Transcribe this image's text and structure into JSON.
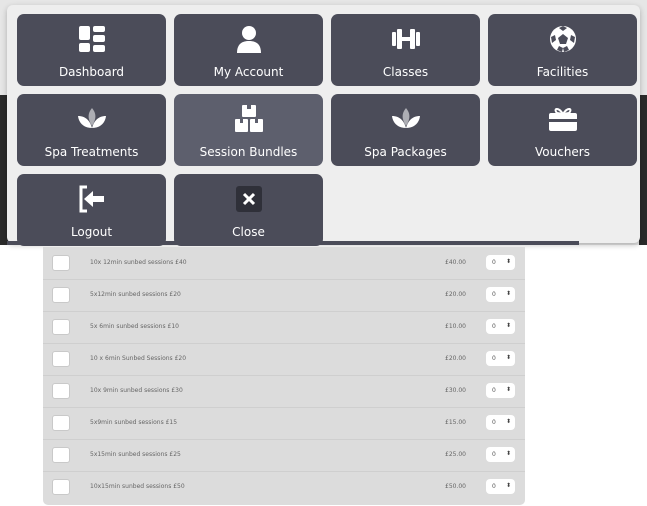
{
  "menu": {
    "tiles": [
      {
        "label": "Dashboard",
        "icon": "dashboard-icon"
      },
      {
        "label": "My Account",
        "icon": "user-icon"
      },
      {
        "label": "Classes",
        "icon": "dumbbell-icon"
      },
      {
        "label": "Facilities",
        "icon": "soccer-ball-icon"
      },
      {
        "label": "Spa Treatments",
        "icon": "lotus-icon"
      },
      {
        "label": "Session Bundles",
        "icon": "boxes-icon"
      },
      {
        "label": "Spa Packages",
        "icon": "lotus-icon"
      },
      {
        "label": "Vouchers",
        "icon": "gift-card-icon"
      },
      {
        "label": "Logout",
        "icon": "logout-icon"
      },
      {
        "label": "Close",
        "icon": "close-icon"
      }
    ]
  },
  "products": [
    {
      "name": "10x 12min sunbed sessions £40",
      "price": "£40.00",
      "qty": "0"
    },
    {
      "name": "5x12min sunbed sessions £20",
      "price": "£20.00",
      "qty": "0"
    },
    {
      "name": "5x 6min sunbed sessions £10",
      "price": "£10.00",
      "qty": "0"
    },
    {
      "name": "10 x 6min Sunbed Sessions £20",
      "price": "£20.00",
      "qty": "0"
    },
    {
      "name": "10x 9min sunbed sessions £30",
      "price": "£30.00",
      "qty": "0"
    },
    {
      "name": "5x9min sunbed sessions £15",
      "price": "£15.00",
      "qty": "0"
    },
    {
      "name": "5x15min sunbed sessions £25",
      "price": "£25.00",
      "qty": "0"
    },
    {
      "name": "10x15min sunbed sessions £50",
      "price": "£50.00",
      "qty": "0"
    }
  ],
  "colors": {
    "tile": "#4b4c59",
    "tile_active": "#5d5f6d",
    "menu_bg": "#eeeeee",
    "list_bg": "#dcdcdc"
  }
}
